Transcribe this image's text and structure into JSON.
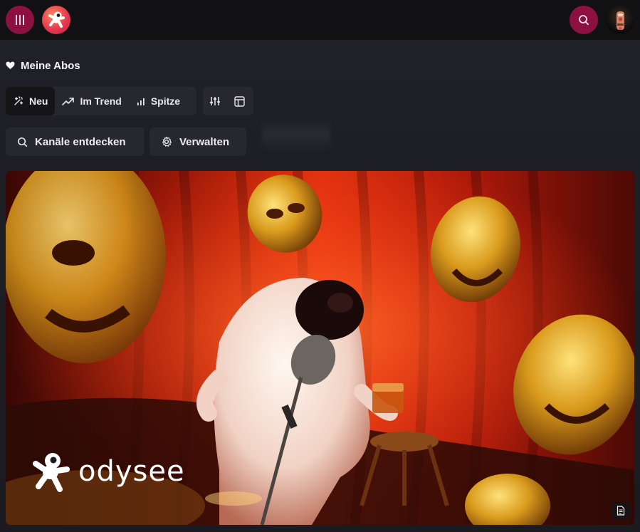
{
  "header": {
    "menu_icon": "menu-bars-icon",
    "logo_icon": "odysee-spaceman-logo",
    "search_icon": "search-icon",
    "avatar_icon": "user-avatar"
  },
  "section": {
    "title": "Meine Abos",
    "icon": "heart-icon"
  },
  "sort_tabs": [
    {
      "label": "Neu",
      "icon": "sparkle-icon",
      "active": true
    },
    {
      "label": "Im Trend",
      "icon": "trending-up-icon",
      "active": false
    },
    {
      "label": "Spitze",
      "icon": "bar-chart-icon",
      "active": false
    }
  ],
  "view_options": [
    {
      "icon": "sliders-icon"
    },
    {
      "icon": "layout-icon"
    }
  ],
  "actions": {
    "discover_label": "Kanäle entdecken",
    "discover_icon": "search-icon",
    "manage_label": "Verwalten",
    "manage_icon": "gear-icon"
  },
  "banner": {
    "brand_text": "odysee",
    "doc_icon": "document-icon"
  },
  "colors": {
    "accent": "#8d1140",
    "topbar": "#111113",
    "background": "#1b1b22",
    "chip": "#272730"
  }
}
